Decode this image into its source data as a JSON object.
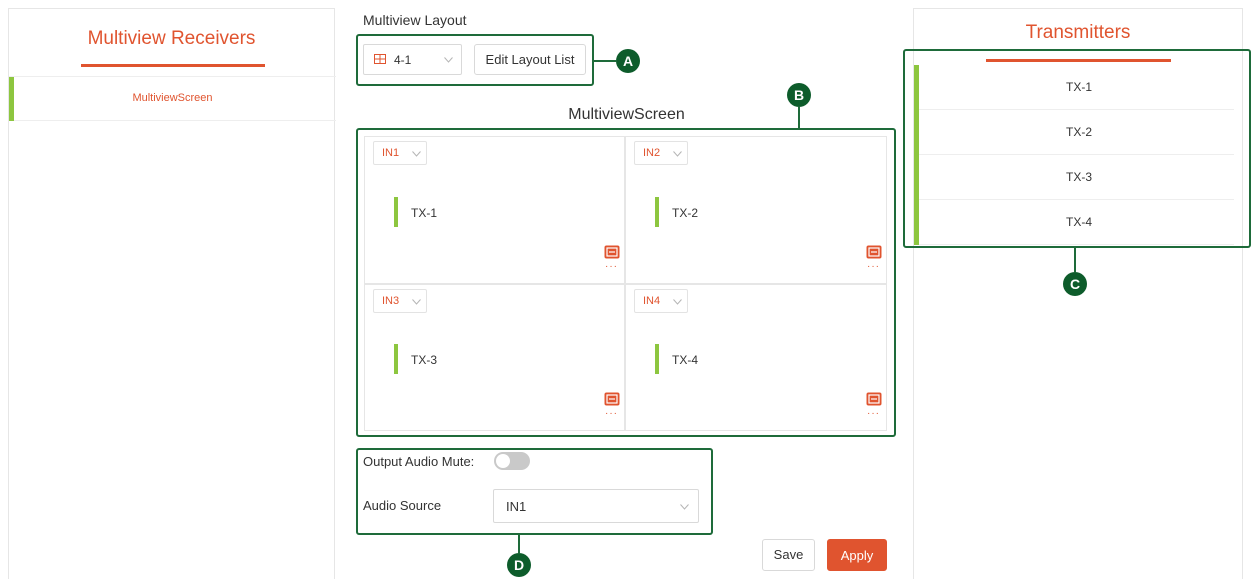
{
  "receivers": {
    "title": "Multiview Receivers",
    "items": [
      {
        "label": "MultiviewScreen"
      }
    ]
  },
  "layout": {
    "title": "Multiview Layout",
    "selected": "4-1",
    "edit_label": "Edit Layout List"
  },
  "screen": {
    "title": "MultiviewScreen",
    "cells": [
      {
        "input": "IN1",
        "transmitter": "TX-1"
      },
      {
        "input": "IN2",
        "transmitter": "TX-2"
      },
      {
        "input": "IN3",
        "transmitter": "TX-3"
      },
      {
        "input": "IN4",
        "transmitter": "TX-4"
      }
    ],
    "more_glyph": "···"
  },
  "transmitters": {
    "title": "Transmitters",
    "items": [
      {
        "label": "TX-1"
      },
      {
        "label": "TX-2"
      },
      {
        "label": "TX-3"
      },
      {
        "label": "TX-4"
      }
    ]
  },
  "audio": {
    "mute_label": "Output Audio Mute:",
    "mute_enabled": false,
    "source_label": "Audio Source",
    "source_value": "IN1"
  },
  "actions": {
    "save_label": "Save",
    "apply_label": "Apply"
  },
  "callouts": {
    "a": "A",
    "b": "B",
    "c": "C",
    "d": "D"
  },
  "colors": {
    "accent": "#e0542f",
    "active_bar": "#8dc63f",
    "callout": "#1e6b3a"
  }
}
